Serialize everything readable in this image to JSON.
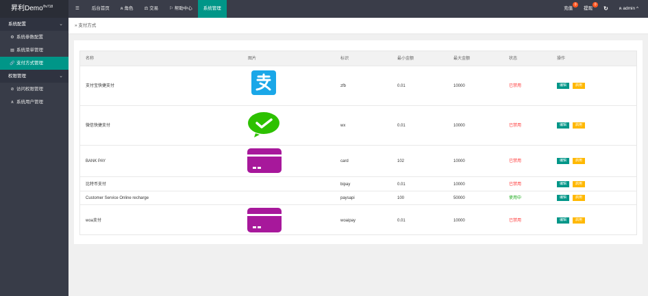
{
  "brand": {
    "name": "昇利Demo",
    "version": "®v718"
  },
  "sidebar": {
    "groups": [
      {
        "label": "系统配置",
        "items": [
          {
            "icon": "gear-icon",
            "glyph": "⚙",
            "label": "系统参数配置",
            "active": false
          },
          {
            "icon": "list-icon",
            "glyph": "▤",
            "label": "系统菜单管理",
            "active": false
          },
          {
            "icon": "link-icon",
            "glyph": "🔗",
            "label": "支付方式管理",
            "active": true
          }
        ]
      },
      {
        "label": "权限管理",
        "items": [
          {
            "icon": "shield-check-icon",
            "glyph": "⊘",
            "label": "访问权限管理",
            "active": false
          },
          {
            "icon": "user-icon",
            "glyph": "ጸ",
            "label": "系统用户管理",
            "active": false
          }
        ]
      }
    ]
  },
  "topbar": {
    "menu_icon": "☰",
    "items": [
      {
        "label": "后台首页",
        "glyph": "",
        "active": false
      },
      {
        "label": "角色",
        "glyph": "ጸ ",
        "active": false
      },
      {
        "label": "交易",
        "glyph": "⚖ ",
        "active": false
      },
      {
        "label": "帮助中心",
        "glyph": "⚐ ",
        "active": false
      },
      {
        "label": "系统管理",
        "glyph": "",
        "active": true
      }
    ],
    "recharge": {
      "label": "充值",
      "badge": "0"
    },
    "withdraw": {
      "label": "提现",
      "badge": "0"
    },
    "refresh": "↻",
    "user": {
      "label": "admin",
      "chevron": "^"
    }
  },
  "breadcrumb": "支付方式",
  "table": {
    "headers": [
      "名称",
      "图片",
      "标识",
      "最小金额",
      "最大金额",
      "状态",
      "操作"
    ],
    "edit_label": "编辑",
    "toggle_label": "启用",
    "rows": [
      {
        "name": "支付宝快捷支付",
        "image": "alipay",
        "code": "zfb",
        "min": "0.01",
        "max": "10000",
        "status": "已禁用",
        "enabled": false
      },
      {
        "name": "微信快捷支付",
        "image": "wechat",
        "code": "wx",
        "min": "0.01",
        "max": "10000",
        "status": "已禁用",
        "enabled": false
      },
      {
        "name": "BANK PAY",
        "image": "card",
        "code": "card",
        "min": "102",
        "max": "10000",
        "status": "已禁用",
        "enabled": false
      },
      {
        "name": "比特币支付",
        "image": "",
        "code": "bipay",
        "min": "0.01",
        "max": "10000",
        "status": "已禁用",
        "enabled": false
      },
      {
        "name": "Customer Service Online recharge",
        "image": "",
        "code": "paysapi",
        "min": "100",
        "max": "50000",
        "status": "使用中",
        "enabled": true
      },
      {
        "name": "woa支付",
        "image": "card",
        "code": "woaipay",
        "min": "0.01",
        "max": "10000",
        "status": "已禁用",
        "enabled": false
      }
    ]
  },
  "colors": {
    "accent": "#009688",
    "warning": "#ffb800",
    "danger": "#ff3333",
    "success": "#1aaa1a",
    "alipay": "#1aa7e8",
    "wechat": "#2dc100",
    "card": "#a7189b"
  }
}
